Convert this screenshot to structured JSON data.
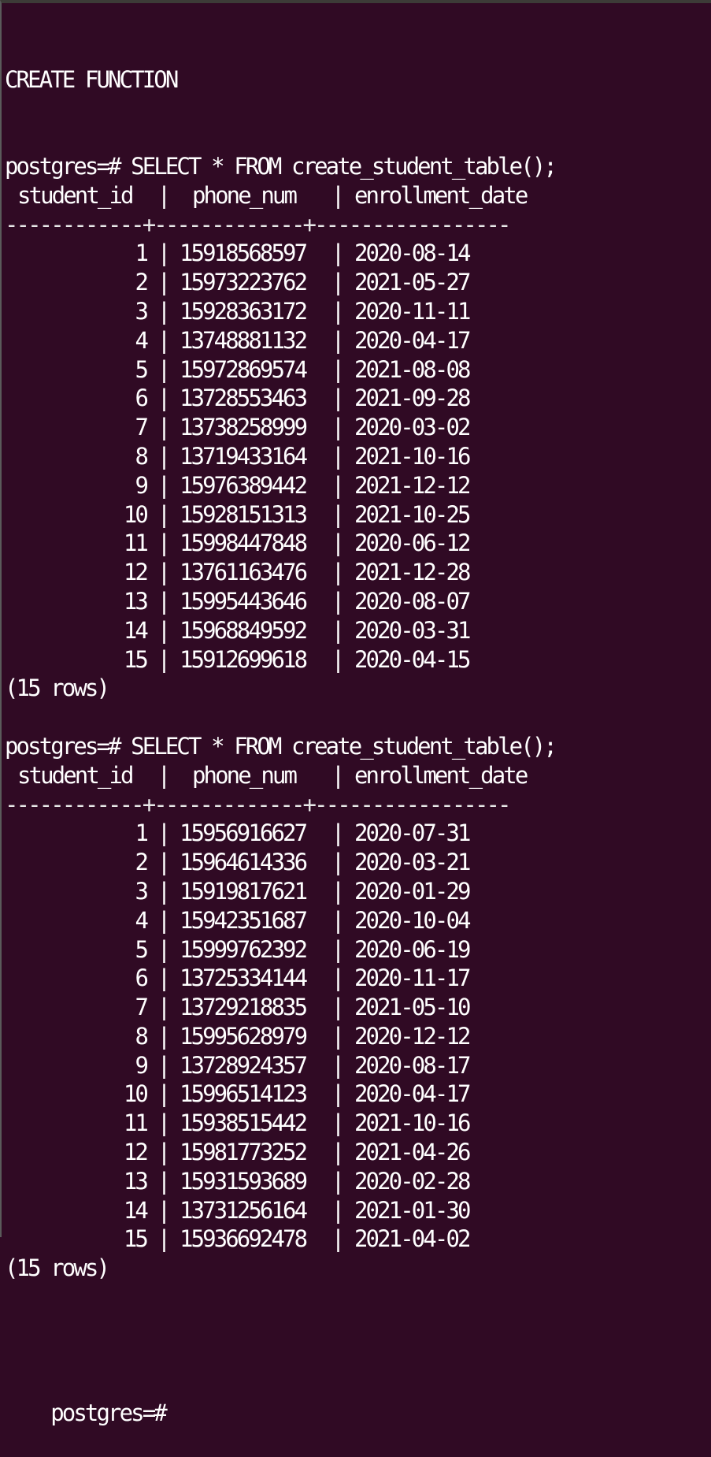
{
  "terminal": {
    "background": "#300a24",
    "foreground": "#ffffff",
    "create_message": "CREATE FUNCTION",
    "prompt": "postgres=#",
    "blocks": [
      {
        "command": "SELECT * FROM create_student_table();",
        "headers": [
          "student_id",
          "phone_num",
          "enrollment_date"
        ],
        "divider": "------------+-------------+-----------------",
        "rows": [
          {
            "student_id": "1",
            "phone_num": "15918568597",
            "enrollment_date": "2020-08-14"
          },
          {
            "student_id": "2",
            "phone_num": "15973223762",
            "enrollment_date": "2021-05-27"
          },
          {
            "student_id": "3",
            "phone_num": "15928363172",
            "enrollment_date": "2020-11-11"
          },
          {
            "student_id": "4",
            "phone_num": "13748881132",
            "enrollment_date": "2020-04-17"
          },
          {
            "student_id": "5",
            "phone_num": "15972869574",
            "enrollment_date": "2021-08-08"
          },
          {
            "student_id": "6",
            "phone_num": "13728553463",
            "enrollment_date": "2021-09-28"
          },
          {
            "student_id": "7",
            "phone_num": "13738258999",
            "enrollment_date": "2020-03-02"
          },
          {
            "student_id": "8",
            "phone_num": "13719433164",
            "enrollment_date": "2021-10-16"
          },
          {
            "student_id": "9",
            "phone_num": "15976389442",
            "enrollment_date": "2021-12-12"
          },
          {
            "student_id": "10",
            "phone_num": "15928151313",
            "enrollment_date": "2021-10-25"
          },
          {
            "student_id": "11",
            "phone_num": "15998447848",
            "enrollment_date": "2020-06-12"
          },
          {
            "student_id": "12",
            "phone_num": "13761163476",
            "enrollment_date": "2021-12-28"
          },
          {
            "student_id": "13",
            "phone_num": "15995443646",
            "enrollment_date": "2020-08-07"
          },
          {
            "student_id": "14",
            "phone_num": "15968849592",
            "enrollment_date": "2020-03-31"
          },
          {
            "student_id": "15",
            "phone_num": "15912699618",
            "enrollment_date": "2020-04-15"
          }
        ],
        "row_count": "(15 rows)"
      },
      {
        "command": "SELECT * FROM create_student_table();",
        "headers": [
          "student_id",
          "phone_num",
          "enrollment_date"
        ],
        "divider": "------------+-------------+-----------------",
        "rows": [
          {
            "student_id": "1",
            "phone_num": "15956916627",
            "enrollment_date": "2020-07-31"
          },
          {
            "student_id": "2",
            "phone_num": "15964614336",
            "enrollment_date": "2020-03-21"
          },
          {
            "student_id": "3",
            "phone_num": "15919817621",
            "enrollment_date": "2020-01-29"
          },
          {
            "student_id": "4",
            "phone_num": "15942351687",
            "enrollment_date": "2020-10-04"
          },
          {
            "student_id": "5",
            "phone_num": "15999762392",
            "enrollment_date": "2020-06-19"
          },
          {
            "student_id": "6",
            "phone_num": "13725334144",
            "enrollment_date": "2020-11-17"
          },
          {
            "student_id": "7",
            "phone_num": "13729218835",
            "enrollment_date": "2021-05-10"
          },
          {
            "student_id": "8",
            "phone_num": "15995628979",
            "enrollment_date": "2020-12-12"
          },
          {
            "student_id": "9",
            "phone_num": "13728924357",
            "enrollment_date": "2020-08-17"
          },
          {
            "student_id": "10",
            "phone_num": "15996514123",
            "enrollment_date": "2020-04-17"
          },
          {
            "student_id": "11",
            "phone_num": "15938515442",
            "enrollment_date": "2021-10-16"
          },
          {
            "student_id": "12",
            "phone_num": "15981773252",
            "enrollment_date": "2021-04-26"
          },
          {
            "student_id": "13",
            "phone_num": "15931593689",
            "enrollment_date": "2020-02-28"
          },
          {
            "student_id": "14",
            "phone_num": "13731256164",
            "enrollment_date": "2021-01-30"
          },
          {
            "student_id": "15",
            "phone_num": "15936692478",
            "enrollment_date": "2021-04-02"
          }
        ],
        "row_count": "(15 rows)"
      }
    ],
    "column_separator": "|"
  }
}
